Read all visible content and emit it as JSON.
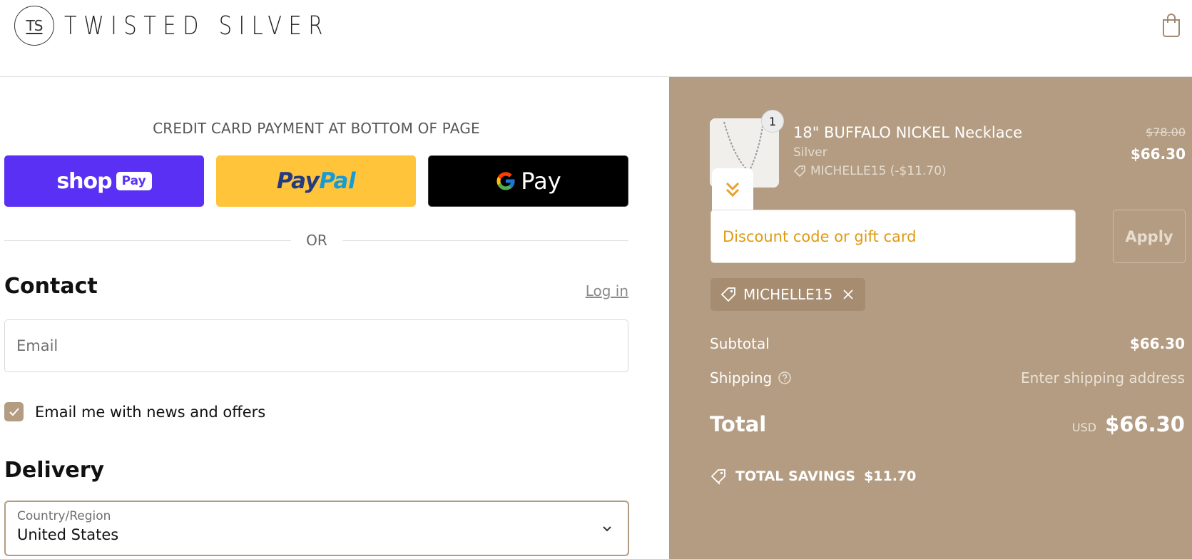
{
  "header": {
    "logo_mark": "TS",
    "brand_name": "TWISTED SILVER",
    "cart_icon": "shopping-bag-icon"
  },
  "express": {
    "heading": "CREDIT CARD PAYMENT AT BOTTOM OF PAGE",
    "shop_pay": {
      "word": "shop",
      "badge": "Pay",
      "color": "#5a31f4"
    },
    "paypal": {
      "part1": "Pay",
      "part2": "Pal",
      "color": "#ffc439"
    },
    "gpay": {
      "word": "Pay",
      "color": "#000000"
    },
    "or_text": "OR"
  },
  "contact": {
    "title": "Contact",
    "login_link": "Log in",
    "email_placeholder": "Email",
    "newsletter_label": "Email me with news and offers",
    "newsletter_checked": true
  },
  "delivery": {
    "title": "Delivery",
    "country_label": "Country/Region",
    "country_value": "United States"
  },
  "summary": {
    "background": "#b39c82",
    "item": {
      "quantity": "1",
      "name": "18\" BUFFALO NICKEL Necklace",
      "variant": "Silver",
      "discount": "MICHELLE15 (-$11.70)",
      "price_original": "$78.00",
      "price_final": "$66.30"
    },
    "discount_placeholder": "Discount code or gift card",
    "apply_label": "Apply",
    "applied_code": "MICHELLE15",
    "subtotal_label": "Subtotal",
    "subtotal_value": "$66.30",
    "shipping_label": "Shipping",
    "shipping_value": "Enter shipping address",
    "total_label": "Total",
    "total_currency": "USD",
    "total_value": "$66.30",
    "savings_label": "TOTAL SAVINGS",
    "savings_value": "$11.70"
  }
}
